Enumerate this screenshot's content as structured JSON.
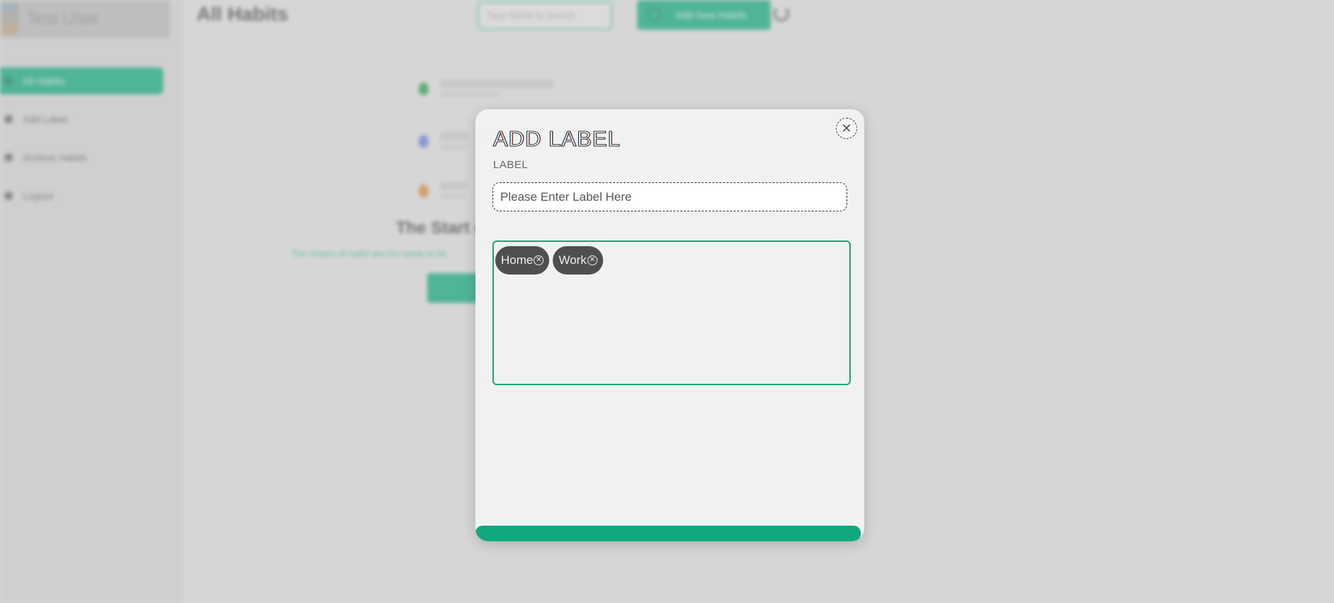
{
  "background": {
    "user_name": "Test User",
    "page_title": "All Habits",
    "search_placeholder": "Type Name to Search",
    "add_habit_label": "Add New Habits",
    "nav": [
      {
        "label": "All Habits",
        "active": true
      },
      {
        "label": "Add Label",
        "active": false
      },
      {
        "label": "Archive Habits",
        "active": false
      },
      {
        "label": "Logout",
        "active": false
      }
    ],
    "empty_title": "The Start of",
    "empty_subtitle": "The chains of habit are too weak to be"
  },
  "modal": {
    "title": "ADD LABEL",
    "close_icon": "close-icon",
    "field_label": "LABEL",
    "input_placeholder": "Please Enter Label Here",
    "input_value": "",
    "chips": [
      {
        "label": "Home",
        "remove_icon": "close-circle-icon"
      },
      {
        "label": "Work",
        "remove_icon": "close-circle-icon"
      }
    ],
    "submit_label": ""
  },
  "colors": {
    "accent": "#10a97e",
    "chip_bg": "#4f4f4f",
    "modal_bg": "#f1f1f1"
  }
}
